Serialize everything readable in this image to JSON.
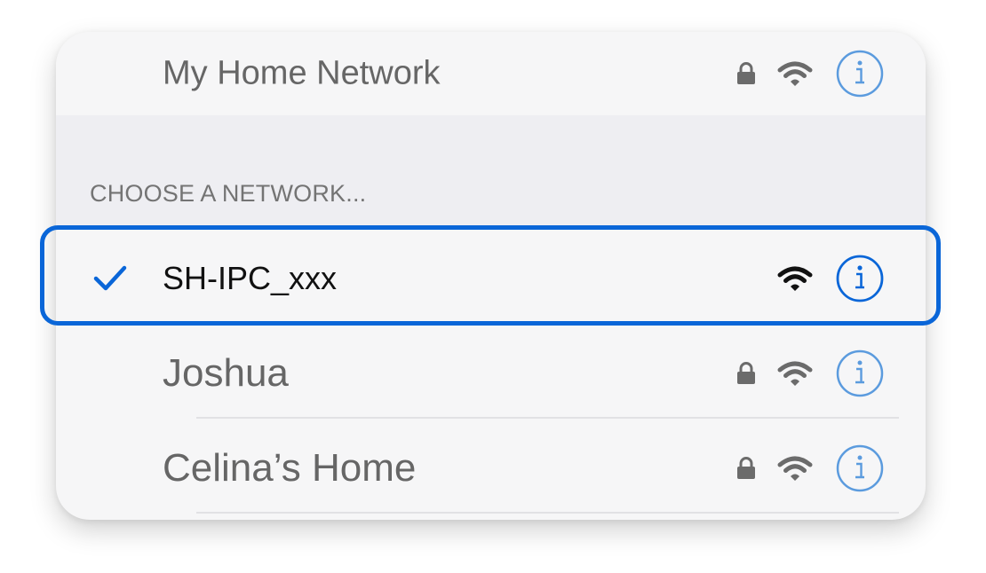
{
  "current_network": {
    "name": "My Home Network",
    "locked": true,
    "signal": "full",
    "info_icon": "info-icon"
  },
  "section": {
    "header": "CHOOSE A NETWORK..."
  },
  "networks": [
    {
      "name": "SH-IPC_xxx",
      "selected": true,
      "locked": false,
      "signal": "full",
      "check_icon": "checkmark-icon"
    },
    {
      "name": "Joshua",
      "selected": false,
      "locked": true,
      "signal": "full"
    },
    {
      "name": "Celina’s Home",
      "selected": false,
      "locked": true,
      "signal": "full"
    }
  ],
  "colors": {
    "accent": "#0a66d8",
    "info_light": "#5b9bde",
    "card_bg": "#f6f6f7",
    "section_bg": "#eeeef2",
    "icon_gray": "#6b6b6b"
  }
}
